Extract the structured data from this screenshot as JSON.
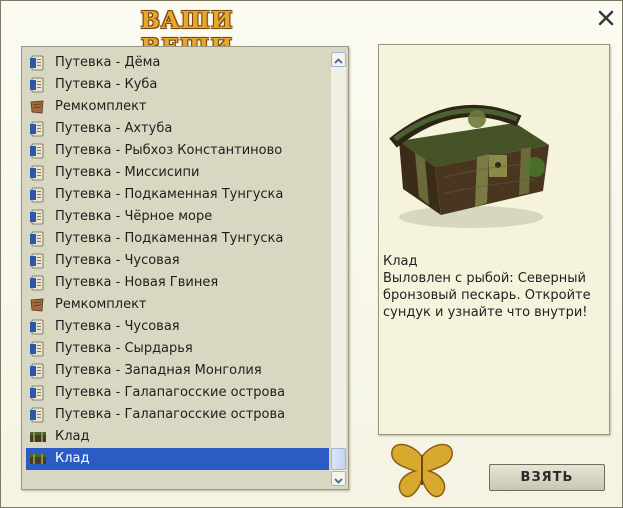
{
  "window": {
    "title": "ваши вещи"
  },
  "list": {
    "items": [
      {
        "label": "Путевка - Дёма",
        "icon": "voucher-icon"
      },
      {
        "label": "Путевка - Куба",
        "icon": "voucher-icon"
      },
      {
        "label": "Ремкомплект",
        "icon": "repair-kit-icon"
      },
      {
        "label": "Путевка - Ахтуба",
        "icon": "voucher-icon"
      },
      {
        "label": "Путевка - Рыбхоз Константиново",
        "icon": "voucher-icon"
      },
      {
        "label": "Путевка - Миссисипи",
        "icon": "voucher-icon"
      },
      {
        "label": "Путевка - Подкаменная Тунгуска",
        "icon": "voucher-icon"
      },
      {
        "label": "Путевка - Чёрное море",
        "icon": "voucher-icon"
      },
      {
        "label": "Путевка - Подкаменная Тунгуска",
        "icon": "voucher-icon"
      },
      {
        "label": "Путевка - Чусовая",
        "icon": "voucher-icon"
      },
      {
        "label": "Путевка - Новая Гвинея",
        "icon": "voucher-icon"
      },
      {
        "label": "Ремкомплект",
        "icon": "repair-kit-icon"
      },
      {
        "label": "Путевка - Чусовая",
        "icon": "voucher-icon"
      },
      {
        "label": "Путевка - Сырдарья",
        "icon": "voucher-icon"
      },
      {
        "label": "Путевка - Западная Монголия",
        "icon": "voucher-icon"
      },
      {
        "label": "Путевка - Галапагосские острова",
        "icon": "voucher-icon"
      },
      {
        "label": "Путевка - Галапагосские острова",
        "icon": "voucher-icon"
      },
      {
        "label": "Клад",
        "icon": "treasure-chest-icon"
      },
      {
        "label": "Клад",
        "icon": "treasure-chest-icon",
        "selected": true
      }
    ],
    "scroll_position": 0.96
  },
  "detail": {
    "image": "treasure-chest-icon",
    "name": "Клад",
    "description": "Выловлен с рыбой: Северный бронзовый пескарь. Откройте сундук и узнайте что внутри!"
  },
  "actions": {
    "take_label": "ВЗЯТЬ"
  },
  "colors": {
    "selection": "#2d5bc4",
    "title": "#e6a72c",
    "list_bg": "#d8d7c2",
    "panel_bg": "#f6f3dc"
  }
}
